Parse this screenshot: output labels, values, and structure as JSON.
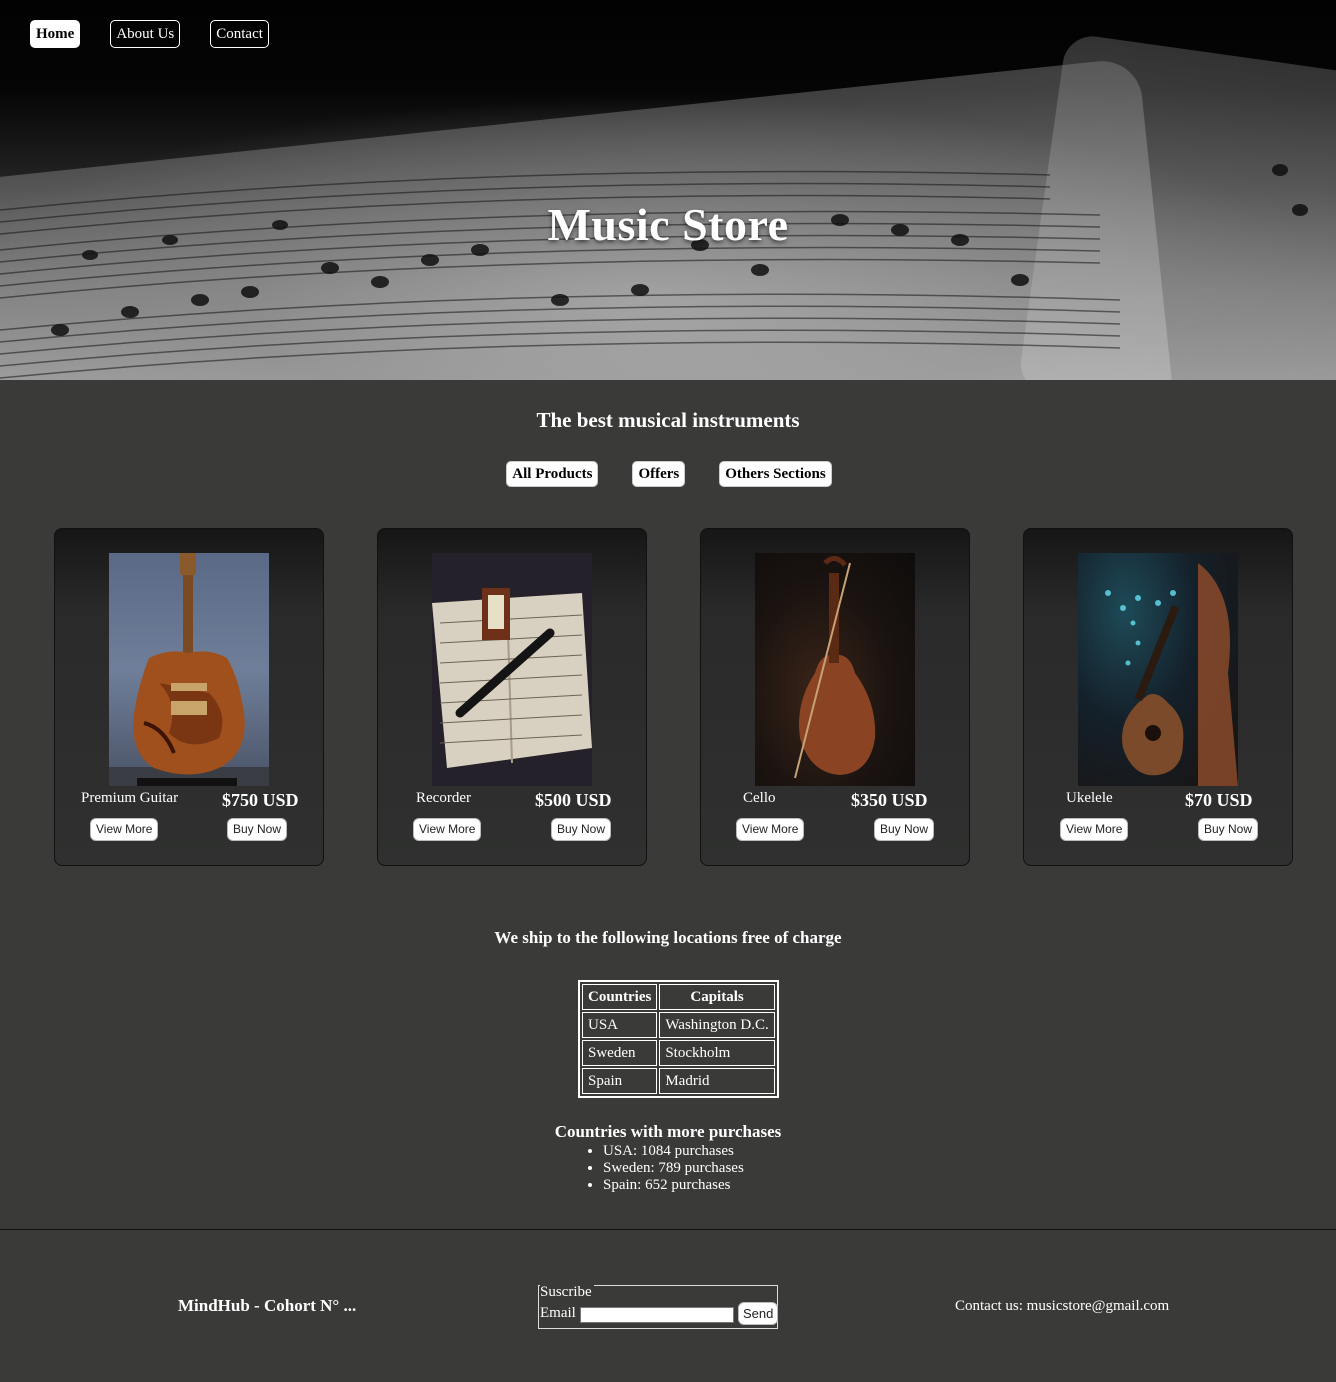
{
  "nav": {
    "items": [
      {
        "label": "Home",
        "active": true
      },
      {
        "label": "About Us",
        "active": false
      },
      {
        "label": "Contact",
        "active": false
      }
    ]
  },
  "hero": {
    "title": "Music Store"
  },
  "main": {
    "heading": "The best musical instruments",
    "filters": [
      "All Products",
      "Offers",
      "Others Sections"
    ]
  },
  "products": [
    {
      "name": "Premium Guitar",
      "price": "$750 USD",
      "view_label": "View More",
      "buy_label": "Buy Now",
      "image": "electric-guitar-photo"
    },
    {
      "name": "Recorder",
      "price": "$500 USD",
      "view_label": "View More",
      "buy_label": "Buy Now",
      "image": "recorder-on-sheet-music-photo"
    },
    {
      "name": "Cello",
      "price": "$350 USD",
      "view_label": "View More",
      "buy_label": "Buy Now",
      "image": "cello-photo"
    },
    {
      "name": "Ukelele",
      "price": "$70 USD",
      "view_label": "View More",
      "buy_label": "Buy Now",
      "image": "ukulele-photo"
    }
  ],
  "shipping": {
    "title": "We ship to the following locations free of charge",
    "headers": [
      "Countries",
      "Capitals"
    ],
    "rows": [
      [
        "USA",
        "Washington D.C."
      ],
      [
        "Sweden",
        "Stockholm"
      ],
      [
        "Spain",
        "Madrid"
      ]
    ]
  },
  "purchases": {
    "title": "Countries with more purchases",
    "items": [
      "USA: 1084 purchases",
      "Sweden: 789 purchases",
      "Spain: 652 purchases"
    ]
  },
  "footer": {
    "brand": "MindHub - Cohort N° ...",
    "subscribe_legend": "Suscribe",
    "email_label": "Email",
    "send_label": "Send",
    "contact": "Contact us: musicstore@gmail.com"
  },
  "colors": {
    "background": "#3a3b39",
    "card_border": "#111111",
    "text": "#ffffff"
  }
}
